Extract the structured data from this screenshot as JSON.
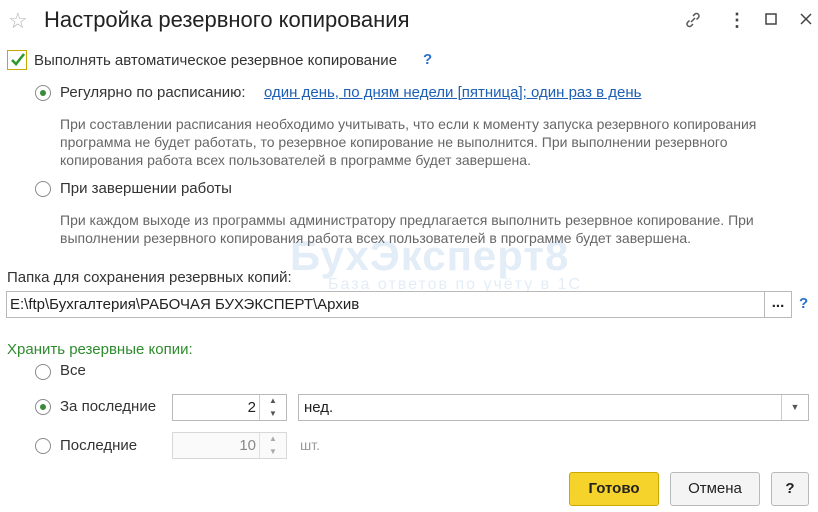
{
  "window": {
    "title": "Настройка резервного копирования"
  },
  "auto_backup": {
    "label": "Выполнять автоматическое резервное копирование",
    "checked": true,
    "help": "?"
  },
  "schedule": {
    "label": "Регулярно по расписанию:",
    "link": "один день, по дням недели [пятница]; один раз в день",
    "note": "При составлении расписания необходимо учитывать, что если к моменту запуска резервного копирования программа не будет работать, то резервное копирование не выполнится. При выполнении резервного копирования работа всех пользователей в программе будет завершена."
  },
  "on_exit": {
    "label": "При завершении работы",
    "note": "При каждом выходе из программы администратору предлагается выполнить резервное копирование. При выполнении резервного копирования работа всех пользователей в программе будет завершена."
  },
  "folder": {
    "label": "Папка для сохранения резервных копий:",
    "value": "E:\\ftp\\Бухгалтерия\\РАБОЧАЯ БУХЭКСПЕРТ\\Архив",
    "browse": "...",
    "help": "?"
  },
  "keep": {
    "label": "Хранить резервные копии:",
    "all_label": "Все",
    "last_period_label": "За последние",
    "last_period_value": "2",
    "last_period_unit": "нед.",
    "last_count_label": "Последние",
    "last_count_value": "10",
    "last_count_unit": "шт."
  },
  "watermark": {
    "main": "БухЭксперт8",
    "sub": "База ответов по учёту в 1С"
  },
  "buttons": {
    "ok": "Готово",
    "cancel": "Отмена",
    "help": "?"
  },
  "colors": {
    "accent_yellow": "#f6d32a",
    "link_blue": "#1d5fb5",
    "green_label": "#2e8b2e"
  }
}
